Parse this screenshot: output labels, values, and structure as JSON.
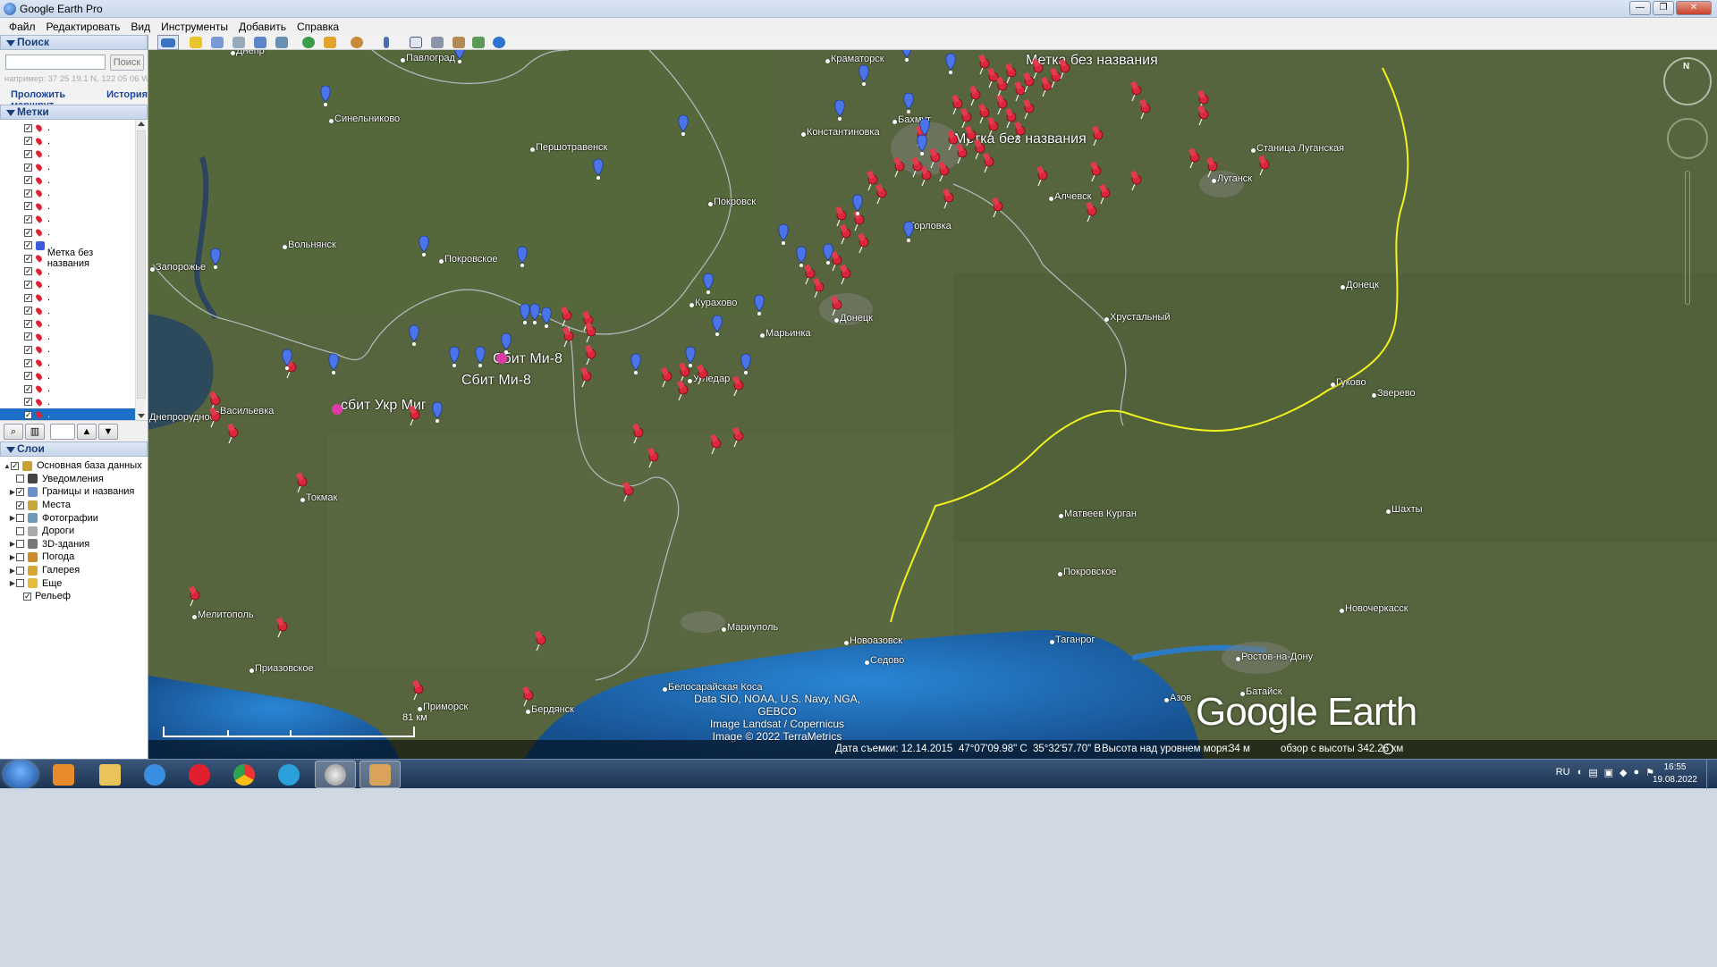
{
  "window": {
    "title": "Google Earth Pro",
    "buttons": [
      "—",
      "❐",
      "✕"
    ]
  },
  "menu": [
    "Файл",
    "Редактировать",
    "Вид",
    "Инструменты",
    "Добавить",
    "Справка"
  ],
  "search": {
    "header": "Поиск",
    "placeholder": "",
    "button": "Поиск",
    "hint": "например: 37 25 19.1 N, 122 05 06 W",
    "route_link": "Проложить маршрут",
    "history_link": "История"
  },
  "places": {
    "header": "Метки",
    "items": [
      {
        "label": ".",
        "checked": true,
        "icon": "red-pushpin"
      },
      {
        "label": ".",
        "checked": true,
        "icon": "red-pushpin"
      },
      {
        "label": ".",
        "checked": true,
        "icon": "red-pushpin"
      },
      {
        "label": ".",
        "checked": true,
        "icon": "red-pushpin"
      },
      {
        "label": ".",
        "checked": true,
        "icon": "red-pushpin"
      },
      {
        "label": ".",
        "checked": true,
        "icon": "red-pushpin"
      },
      {
        "label": ".",
        "checked": true,
        "icon": "red-pushpin"
      },
      {
        "label": ".",
        "checked": true,
        "icon": "red-pushpin"
      },
      {
        "label": ".",
        "checked": true,
        "icon": "red-pushpin"
      },
      {
        "label": ".",
        "checked": true,
        "icon": "blue-square"
      },
      {
        "label": "Метка без названия",
        "checked": true,
        "icon": "red-pushpin"
      },
      {
        "label": ".",
        "checked": true,
        "icon": "red-pushpin"
      },
      {
        "label": ".",
        "checked": true,
        "icon": "red-pushpin"
      },
      {
        "label": ".",
        "checked": true,
        "icon": "red-pushpin"
      },
      {
        "label": ".",
        "checked": true,
        "icon": "red-pushpin"
      },
      {
        "label": ".",
        "checked": true,
        "icon": "red-pushpin"
      },
      {
        "label": ".",
        "checked": true,
        "icon": "red-pushpin"
      },
      {
        "label": ".",
        "checked": true,
        "icon": "red-pushpin"
      },
      {
        "label": ".",
        "checked": true,
        "icon": "red-pushpin"
      },
      {
        "label": ".",
        "checked": true,
        "icon": "red-pushpin"
      },
      {
        "label": ".",
        "checked": true,
        "icon": "red-pushpin"
      },
      {
        "label": ".",
        "checked": true,
        "icon": "red-pushpin"
      },
      {
        "label": ".",
        "checked": true,
        "icon": "red-pushpin",
        "selected": true
      }
    ]
  },
  "layers": {
    "header": "Слои",
    "items": [
      {
        "label": "Основная база данных",
        "checked": true,
        "expander": "▲"
      },
      {
        "label": "Уведомления",
        "checked": false,
        "expander": ""
      },
      {
        "label": "Границы и названия",
        "checked": true,
        "expander": "▶"
      },
      {
        "label": "Места",
        "checked": true,
        "expander": ""
      },
      {
        "label": "Фотографии",
        "checked": false,
        "expander": "▶"
      },
      {
        "label": "Дороги",
        "checked": false,
        "expander": ""
      },
      {
        "label": "3D-здания",
        "checked": false,
        "expander": "▶"
      },
      {
        "label": "Погода",
        "checked": false,
        "expander": "▶"
      },
      {
        "label": "Галерея",
        "checked": false,
        "expander": "▶"
      },
      {
        "label": "Еще",
        "checked": false,
        "expander": "▶"
      },
      {
        "label": "Рельеф",
        "checked": true,
        "expander": ""
      }
    ]
  },
  "map": {
    "cities": [
      "Днепр",
      "Павлоград",
      "Краматорск",
      "Синельниково",
      "Першотравенск",
      "Константиновка",
      "Бахмут",
      "Станица Луганская",
      "Луганск",
      "Алчевск",
      "Покровск",
      "Горловка",
      "Вольнянск",
      "Запорожье",
      "Покровское",
      "Курахово",
      "Донецк",
      "Марьинка",
      "Хрустальный",
      "Донецк",
      "Днепрорудное",
      "Васильевка",
      "Угледар",
      "Гуково",
      "Зверево",
      "Токмак",
      "Матвеев Курган",
      "Шахты",
      "Покровское",
      "Мелитополь",
      "Новочеркасск",
      "Мариуполь",
      "Новоазовск",
      "Таганрог",
      "Приазовское",
      "Седово",
      "Ростов-на-Дону",
      "Белосарайская Коса",
      "Батайск",
      "Азов",
      "Приморск",
      "Бердянск"
    ],
    "placemark_labels": [
      "Метка без названия",
      "Метка без названия",
      "Сбит Ми-8",
      "Сбит Ми-8",
      "сбит Укр Миг"
    ],
    "credits": [
      "Data SIO, NOAA, U.S. Navy, NGA, GEBCO",
      "Image Landsat / Copernicus",
      "Image © 2022 TerraMetrics"
    ],
    "logo": "Google Earth",
    "compass_n": "N",
    "scale": "81 км",
    "status": {
      "date": "Дата съемки: 12.14.2015",
      "lat": "47°07'09.98\" С",
      "lon": "35°32'57.70\" В",
      "elev_label": "Высота над уровнем моря:",
      "elev": "34 м",
      "eye": "обзор с высоты 342.26 км"
    }
  },
  "taskbar": {
    "apps": [
      "media-player",
      "file-explorer",
      "internet-explorer",
      "opera",
      "chrome",
      "telegram",
      "google-earth-pro",
      "paint"
    ],
    "lang": "RU",
    "time": "16:55",
    "date": "19.08.2022"
  },
  "colors": {
    "accent": "#1b6fc9",
    "pin_red": "#d8263a",
    "pin_blue": "#4a74e8",
    "border_yellow": "#f2f21e",
    "sea": "#1d6fb8"
  }
}
